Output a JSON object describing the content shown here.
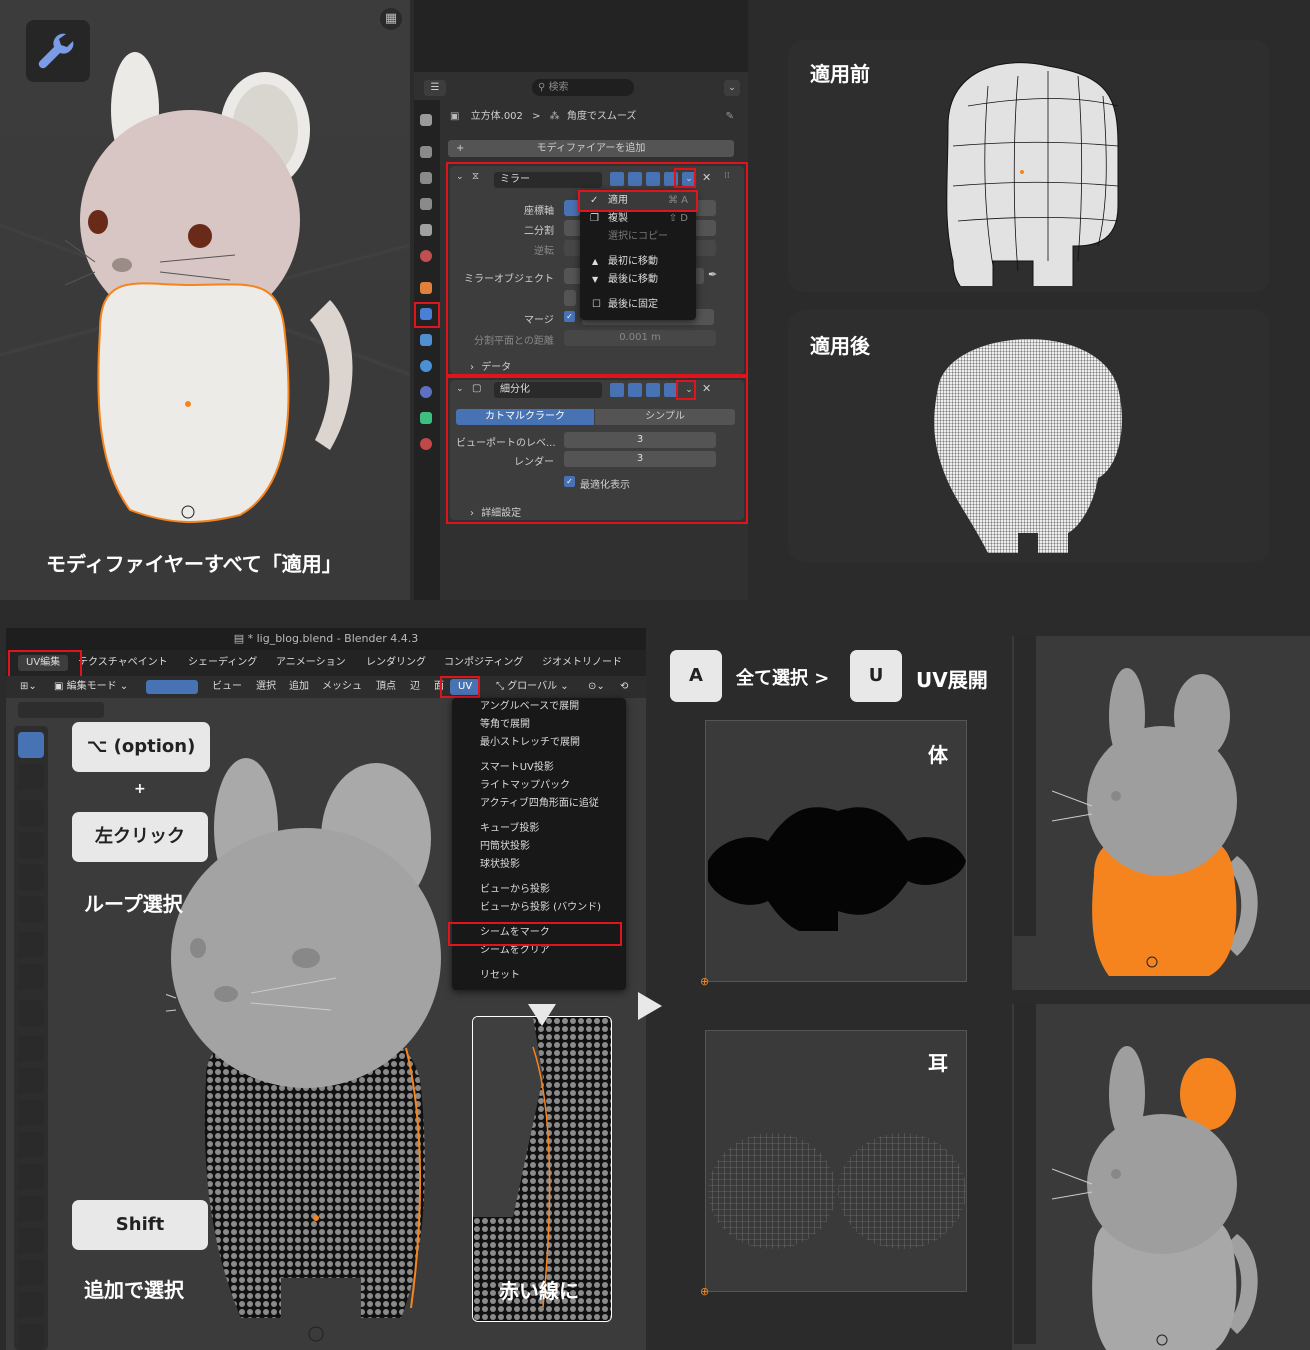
{
  "captions": {
    "apply_all": "モディファイヤーすべて「適用」",
    "before": "適用前",
    "after": "適用後",
    "loop_select": "ループ選択",
    "plus": "+",
    "add_select": "追加で選択",
    "red_line": "赤い線に",
    "select_all": "全て選択 >",
    "uv_unwrap": "UV展開",
    "body": "体",
    "ear": "耳"
  },
  "keys": {
    "option": "⌥ (option)",
    "left_click": "左クリック",
    "shift": "Shift",
    "a": "A",
    "u": "U"
  },
  "properties": {
    "search_placeholder": "検索",
    "breadcrumb_object": "立方体.002",
    "breadcrumb_sep": ">",
    "breadcrumb_modifier": "角度でスムーズ",
    "add_modifier": "モディファイアーを追加",
    "mirror": {
      "name": "ミラー",
      "axis_label": "座標軸",
      "bisect_label": "二分割",
      "flip_label": "逆転",
      "mirror_object_label": "ミラーオブジェクト",
      "merge_label": "マージ",
      "clip_dist_label": "分割平面との距離",
      "clip_dist_value": "0.001 m",
      "data_label": "データ"
    },
    "subsurf": {
      "name": "細分化",
      "tab_catmull": "カトマルクラーク",
      "tab_simple": "シンプル",
      "viewport_levels_label": "ビューポートのレベ...",
      "viewport_levels_value": "3",
      "render_label": "レンダー",
      "render_value": "3",
      "optimal_label": "最適化表示",
      "advanced_label": "詳細設定"
    },
    "dropdown": [
      {
        "label": "適用",
        "shortcut": "⌘ A"
      },
      {
        "label": "複製",
        "shortcut": "⇧ D"
      },
      {
        "label": "選択にコピー",
        "shortcut": ""
      },
      {
        "label": "最初に移動",
        "shortcut": ""
      },
      {
        "label": "最後に移動",
        "shortcut": ""
      },
      {
        "label": "最後に固定",
        "shortcut": ""
      }
    ]
  },
  "blender": {
    "title": "* lig_blog.blend - Blender 4.4.3",
    "workspace_tabs": [
      "UV編集",
      "テクスチャペイント",
      "シェーディング",
      "アニメーション",
      "レンダリング",
      "コンポジティング",
      "ジオメトリノード"
    ],
    "mode": "編集モード",
    "header_menus": [
      "ビュー",
      "選択",
      "追加",
      "メッシュ",
      "頂点",
      "辺",
      "面",
      "UV"
    ],
    "transform_orientation": "グローバル",
    "uv_menu": [
      [
        "アングルベースで展開",
        "等角で展開",
        "最小ストレッチで展開"
      ],
      [
        "スマートUV投影",
        "ライトマップパック",
        "アクティブ四角形面に追従"
      ],
      [
        "キューブ投影",
        "円筒状投影",
        "球状投影"
      ],
      [
        "ビューから投影",
        "ビューから投影 (バウンド)"
      ],
      [
        "シームをマーク",
        "シームをクリア"
      ],
      [
        "リセット"
      ]
    ]
  },
  "colors": {
    "highlight_red": "#e0141c",
    "selection_orange": "#f5841f",
    "accent_blue": "#4772b3"
  }
}
